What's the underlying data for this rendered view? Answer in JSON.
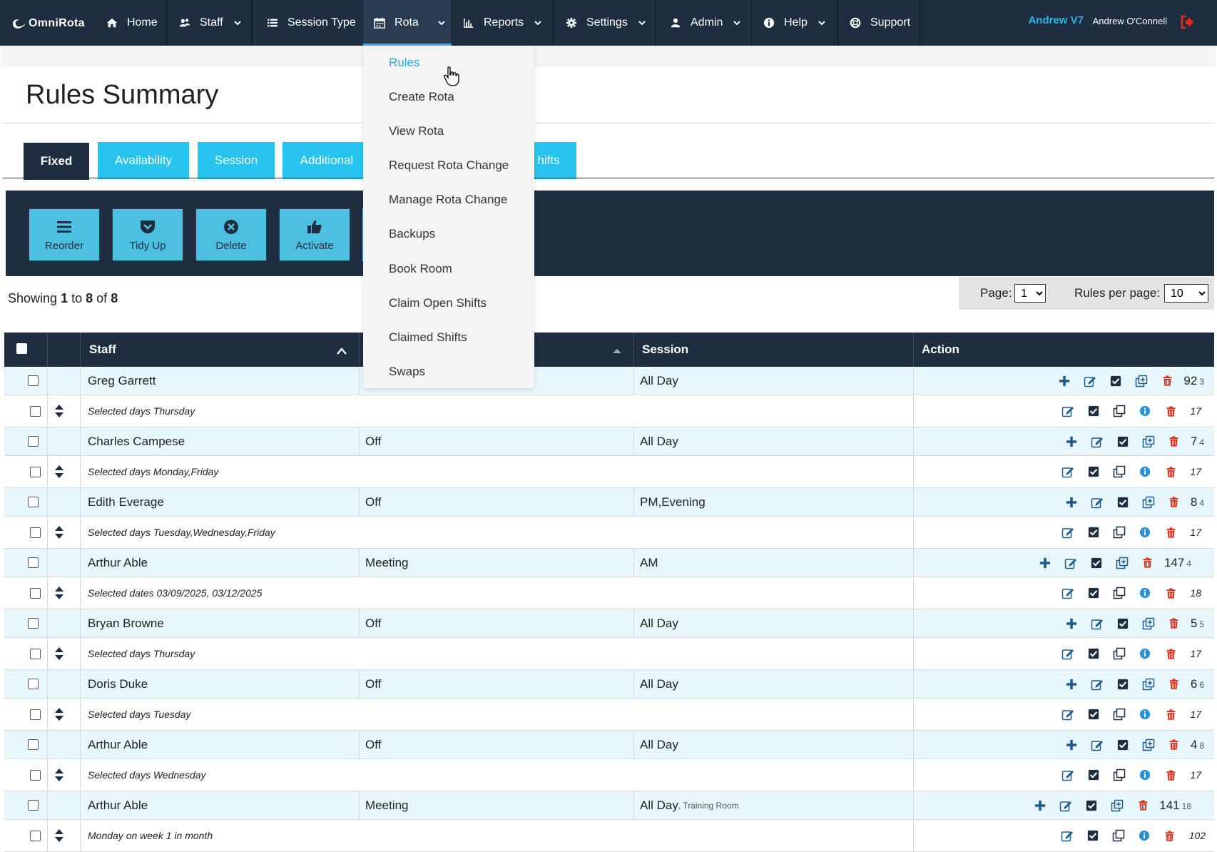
{
  "app": {
    "brand": "OmniRota"
  },
  "nav": {
    "items": [
      {
        "label": "Home",
        "icon": "home-icon"
      },
      {
        "label": "Staff",
        "icon": "users-icon"
      },
      {
        "label": "Session Type",
        "icon": "list-icon"
      },
      {
        "label": "Rota",
        "icon": "calendar-icon"
      },
      {
        "label": "Reports",
        "icon": "bar-chart-icon"
      },
      {
        "label": "Settings",
        "icon": "gear-icon"
      },
      {
        "label": "Admin",
        "icon": "user-icon"
      },
      {
        "label": "Help",
        "icon": "info-icon"
      },
      {
        "label": "Support",
        "icon": "lifebuoy-icon"
      }
    ],
    "active": "Rota",
    "user_short": "Andrew V7",
    "user_full": "Andrew O'Connell"
  },
  "page": {
    "title": "Rules Summary"
  },
  "tabs": [
    {
      "label": "Fixed",
      "active": true
    },
    {
      "label": "Availability"
    },
    {
      "label": "Session"
    },
    {
      "label": "Additional"
    },
    {
      "label": "hifts"
    }
  ],
  "toolbar": {
    "buttons": [
      {
        "label": "Reorder",
        "icon": "bars-icon"
      },
      {
        "label": "Tidy Up",
        "icon": "pocket-icon"
      },
      {
        "label": "Delete",
        "icon": "times-circle-icon"
      },
      {
        "label": "Activate",
        "icon": "thumbs-up-icon"
      }
    ]
  },
  "showing": {
    "prefix": "Showing",
    "from": "1",
    "to_word": "to",
    "to": "8",
    "of_word": "of",
    "total": "8"
  },
  "pager": {
    "page_label": "Page:",
    "page_value": "1",
    "per_page_label": "Rules per page:",
    "per_page_value": "10"
  },
  "table": {
    "headers": {
      "staff": "Staff",
      "session": "Session",
      "action": "Action"
    },
    "rows": [
      {
        "staff": "Greg Garrett",
        "type": "",
        "session": "All Day",
        "id": "92",
        "count": "3",
        "sub": "Selected days Thursday",
        "sub_count": "17"
      },
      {
        "staff": "Charles Campese",
        "type": "Off",
        "session": "All Day",
        "id": "7",
        "count": "4",
        "sub": "Selected days Monday,Friday",
        "sub_count": "17"
      },
      {
        "staff": "Edith Everage",
        "type": "Off",
        "session": "PM,Evening",
        "id": "8",
        "count": "4",
        "sub": "Selected days Tuesday,Wednesday,Friday",
        "sub_count": "17"
      },
      {
        "staff": "Arthur Able",
        "type": "Meeting",
        "session": "AM",
        "id": "147",
        "count": "4",
        "sub": "Selected dates 03/09/2025, 03/12/2025",
        "sub_count": "18"
      },
      {
        "staff": "Bryan Browne",
        "type": "Off",
        "session": "All Day",
        "id": "5",
        "count": "5",
        "sub": "Selected days Thursday",
        "sub_count": "17"
      },
      {
        "staff": "Doris Duke",
        "type": "Off",
        "session": "All Day",
        "id": "6",
        "count": "6",
        "sub": "Selected days Tuesday",
        "sub_count": "17"
      },
      {
        "staff": "Arthur Able",
        "type": "Off",
        "session": "All Day",
        "id": "4",
        "count": "8",
        "sub": "Selected days Wednesday",
        "sub_count": "17"
      },
      {
        "staff": "Arthur Able",
        "type": "Meeting",
        "session": "All Day",
        "venue": ", Training Room",
        "id": "141",
        "count": "18",
        "sub": "Monday on week 1 in month",
        "sub_count": "102"
      }
    ]
  },
  "dropdown": {
    "items": [
      {
        "label": "Rules",
        "active": true
      },
      {
        "label": "Create Rota"
      },
      {
        "label": "View Rota"
      },
      {
        "label": "Request Rota Change"
      },
      {
        "label": "Manage Rota Change"
      },
      {
        "label": "Backups"
      },
      {
        "label": "Book Room"
      },
      {
        "label": "Claim Open Shifts"
      },
      {
        "label": "Claimed Shifts"
      },
      {
        "label": "Swaps"
      }
    ]
  },
  "colors": {
    "navy": "#1e2d3f",
    "accent": "#29c3f0",
    "danger": "#e0301e",
    "row_tint": "#e8f7fc"
  }
}
